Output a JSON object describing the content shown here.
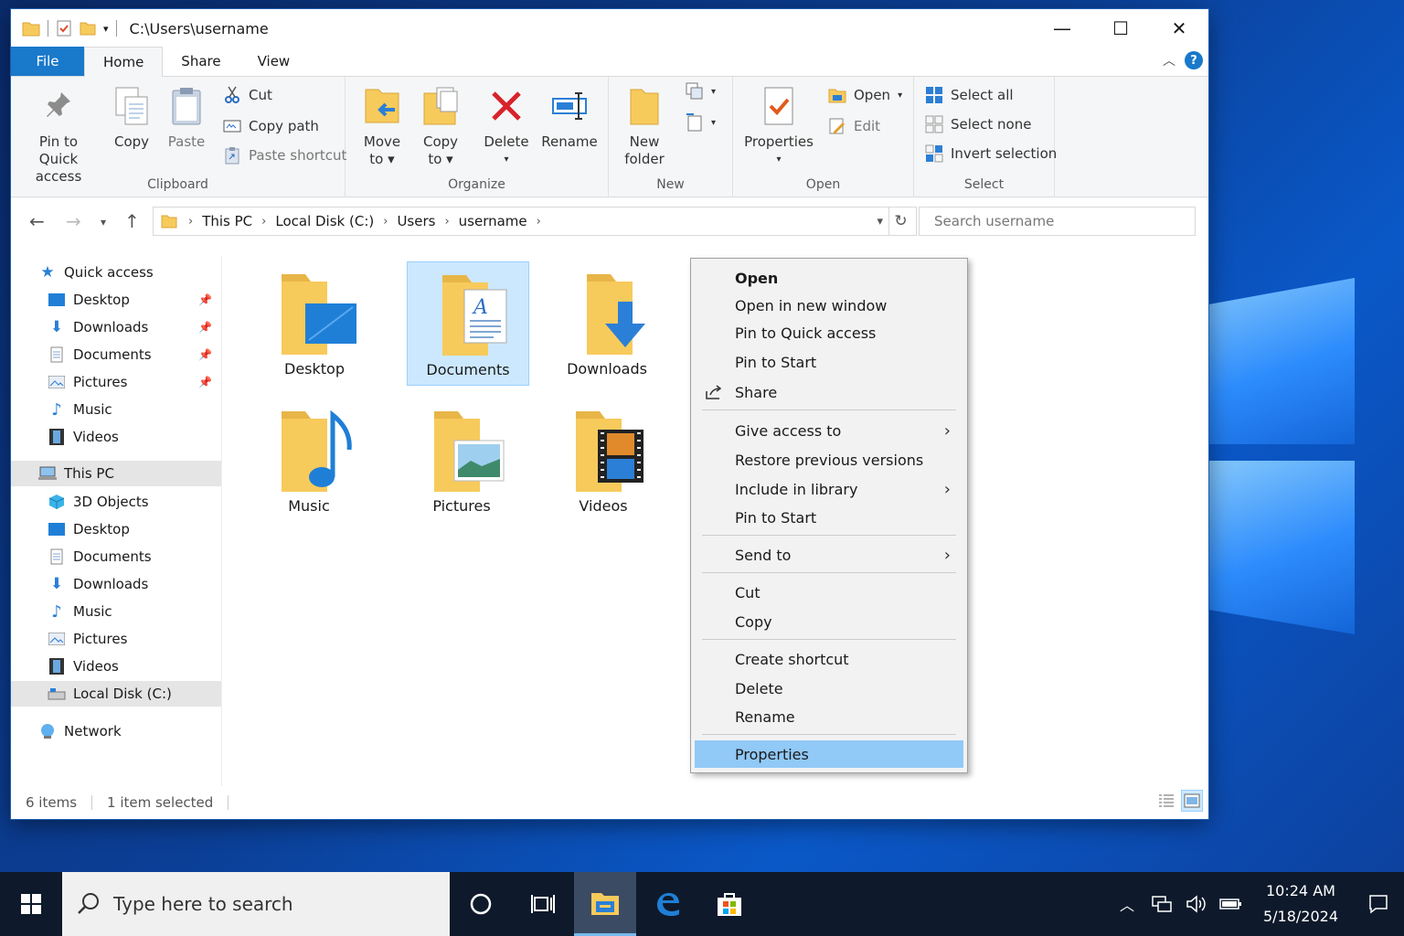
{
  "window": {
    "path": "C:\\Users\\username",
    "controls": {
      "minimize": "—",
      "maximize": "☐",
      "close": "✕"
    }
  },
  "tabs": [
    "File",
    "Home",
    "Share",
    "View"
  ],
  "help_label": "?",
  "ribbon": {
    "clipboard": {
      "label": "Clipboard",
      "pin": "Pin to Quick\naccess",
      "copy": "Copy",
      "paste": "Paste",
      "cut": "Cut",
      "copy_path": "Copy path",
      "paste_shortcut": "Paste shortcut"
    },
    "organize": {
      "label": "Organize",
      "move_to": "Move\nto",
      "copy_to": "Copy\nto",
      "delete": "Delete",
      "rename": "Rename"
    },
    "new": {
      "label": "New",
      "new_folder": "New\nfolder"
    },
    "open": {
      "label": "Open",
      "properties": "Properties",
      "open": "Open",
      "edit": "Edit"
    },
    "select": {
      "label": "Select",
      "select_all": "Select all",
      "select_none": "Select none",
      "invert": "Invert selection"
    }
  },
  "address": {
    "crumbs": [
      "This PC",
      "Local Disk (C:)",
      "Users",
      "username"
    ],
    "search_placeholder": "Search username"
  },
  "nav": {
    "quick_access": "Quick access",
    "quick_items": [
      "Desktop",
      "Downloads",
      "Documents",
      "Pictures",
      "Music",
      "Videos"
    ],
    "this_pc": "This PC",
    "pc_items": [
      "3D Objects",
      "Desktop",
      "Documents",
      "Downloads",
      "Music",
      "Pictures",
      "Videos",
      "Local Disk (C:)"
    ],
    "network": "Network"
  },
  "folders": [
    "Desktop",
    "Documents",
    "Downloads",
    "Music",
    "Pictures",
    "Videos"
  ],
  "status": {
    "count": "6 items",
    "selected": "1 item selected"
  },
  "context_menu": {
    "items": [
      "Open",
      "Open in new window",
      "Pin to Quick access",
      "Pin to Start",
      "Share",
      "Give access to",
      "Restore previous versions",
      "Include in library",
      "Pin to Start",
      "Send to",
      "Cut",
      "Copy",
      "Create shortcut",
      "Delete",
      "Rename",
      "Properties"
    ]
  },
  "taskbar": {
    "search_placeholder": "Type here to search",
    "time": "10:24 AM",
    "date": "5/18/2024"
  },
  "colors": {
    "accent": "#1979ca",
    "selection": "#cce8ff",
    "menu_highlight": "#91c9f7",
    "folder": "#f7ca5c"
  }
}
